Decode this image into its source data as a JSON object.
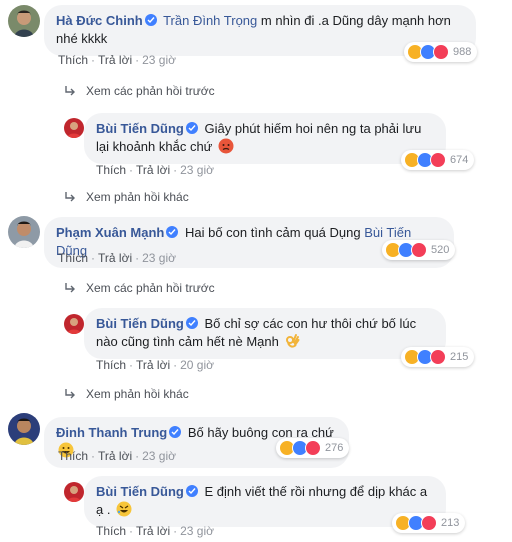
{
  "comments": [
    {
      "author": "Hà Đức Chinh",
      "mention": "Trần Đình Trọng",
      "text": "m nhìn đi .a Dũng dây mạnh hơn nhé kkkk",
      "actions": {
        "like": "Thích",
        "reply": "Trả lời",
        "time": "23 giờ"
      },
      "reaction_count": "988",
      "view_more": "Xem các phản hồi trước"
    },
    {
      "author": "Bùi Tiến Dũng",
      "text": "Giây phút hiếm hoi nên ng ta phải lưu lại khoảnh khắc chứ",
      "actions": {
        "like": "Thích",
        "reply": "Trả lời",
        "time": "23 giờ"
      },
      "reaction_count": "674",
      "view_more": "Xem phản hồi khác"
    },
    {
      "author": "Phạm Xuân Mạnh",
      "text": "Hai bố con tình cảm quá Dụng",
      "mention": "Bùi Tiến Dũng",
      "actions": {
        "like": "Thích",
        "reply": "Trả lời",
        "time": "23 giờ"
      },
      "reaction_count": "520",
      "view_more": "Xem các phản hồi trước"
    },
    {
      "author": "Bùi Tiến Dũng",
      "text": "Bố chỉ sợ các con hư thôi chứ bố lúc nào cũng tình cảm hết nè Mạnh",
      "actions": {
        "like": "Thích",
        "reply": "Trả lời",
        "time": "20 giờ"
      },
      "reaction_count": "215",
      "view_more": "Xem phản hồi khác"
    },
    {
      "author": "Đinh Thanh Trung",
      "text": "Bố hãy buông con ra chứ",
      "actions": {
        "like": "Thích",
        "reply": "Trả lời",
        "time": "23 giờ"
      },
      "reaction_count": "276"
    },
    {
      "author": "Bùi Tiến Dũng",
      "text": "E định viết thế rồi nhưng để dịp khác a ạ .",
      "actions": {
        "like": "Thích",
        "reply": "Trả lời",
        "time": "23 giờ"
      },
      "reaction_count": "213"
    }
  ],
  "colors": {
    "link": "#385898",
    "bubble": "#f2f3f5",
    "like_blue": "#4080ff",
    "love_red": "#f33e58",
    "haha_yellow": "#f7b125"
  }
}
